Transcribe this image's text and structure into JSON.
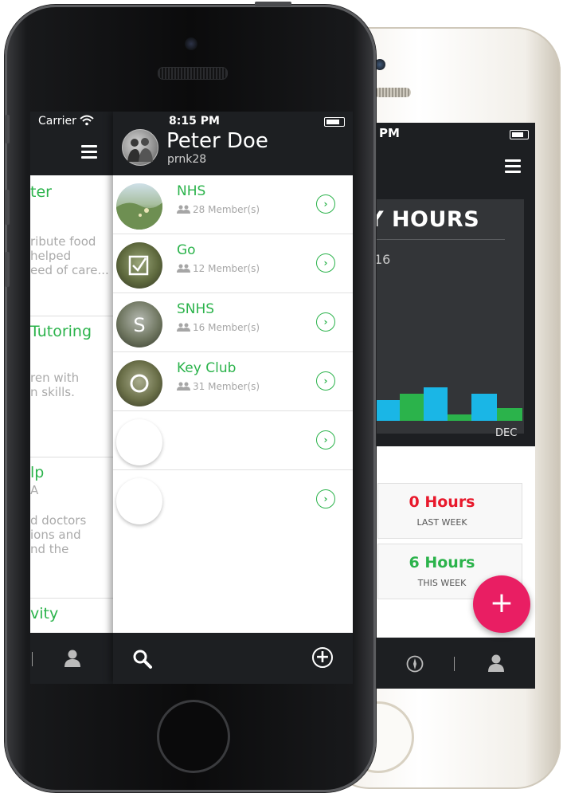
{
  "back_app": {
    "status_time": "PM",
    "chart_title": "Y HOURS",
    "chart_subtitle": "16",
    "chart_month": "DEC",
    "bar_colors": [
      "#1ab6e6",
      "#2bb34b",
      "#1ab6e6",
      "#2bb34b",
      "#1ab6e6",
      "#2bb34b"
    ],
    "stats": [
      {
        "value": "0 Hours",
        "label": "LAST WEEK",
        "color": "#e8192c"
      },
      {
        "value": "6 Hours",
        "label": "THIS WEEK",
        "color": "#2bb34b"
      }
    ],
    "fab_label": "+",
    "tab_icons": [
      "compass-icon",
      "person-icon"
    ]
  },
  "drawer": {
    "carrier": "Carrier",
    "items": [
      {
        "title": "ter",
        "desc": [
          "ribute food",
          "helped",
          "eed of care..."
        ]
      },
      {
        "title": "Tutoring",
        "desc": [
          "ren with",
          "n skills."
        ]
      },
      {
        "title": "lp",
        "desc": [
          "A",
          "d doctors",
          "ions and",
          "nd the"
        ]
      },
      {
        "title": "vity",
        "desc": []
      }
    ],
    "tab_icons": [
      "person-icon"
    ]
  },
  "groups_screen": {
    "status_time": "8:15 PM",
    "profile": {
      "name": "Peter Doe",
      "username": "prnk28"
    },
    "groups": [
      {
        "name": "NHS",
        "members": "28 Member(s)",
        "avatar": "meadow-photo"
      },
      {
        "name": "Go",
        "members": "12 Member(s)",
        "avatar": "checkbox-photo"
      },
      {
        "name": "SNHS",
        "members": "16 Member(s)",
        "avatar": "letter-s-photo"
      },
      {
        "name": "Key Club",
        "members": "31 Member(s)",
        "avatar": "ring-photo"
      },
      {
        "name": "",
        "members": "",
        "avatar": "empty"
      },
      {
        "name": "",
        "members": "",
        "avatar": "empty"
      }
    ],
    "chevron_glyph": "›",
    "add_glyph": "+",
    "tab_icons": [
      "search-icon",
      "add-circle-icon"
    ]
  },
  "colors": {
    "accent_green": "#2bb34b",
    "fab_pink": "#e91e63",
    "chart_blue": "#1ab6e6",
    "header_dark": "#1d1f22"
  }
}
